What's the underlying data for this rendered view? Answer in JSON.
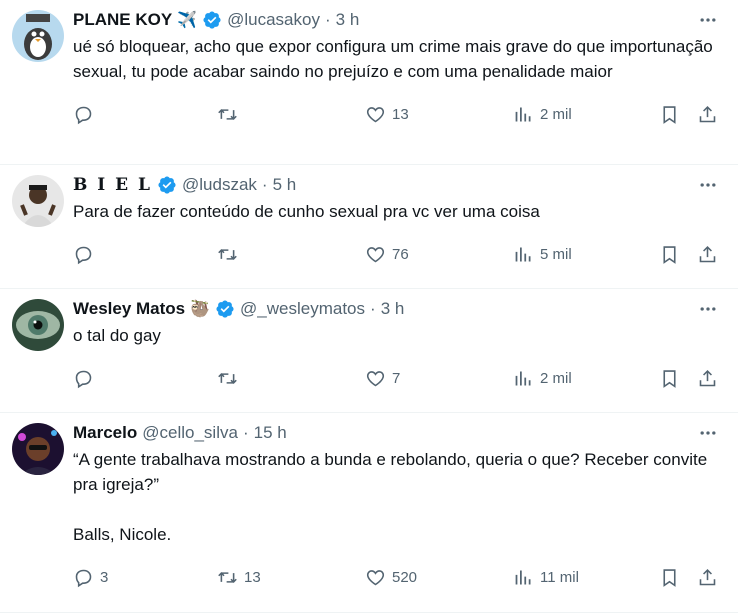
{
  "tweets": [
    {
      "name": "PLANE KOY",
      "emoji": "✈️",
      "handle": "@lucasakoy",
      "dot": "·",
      "time": "3 h",
      "text": "ué só bloquear, acho que expor configura um crime mais grave do que importunação sexual, tu pode acabar saindo no prejuízo e com uma penalidade maior",
      "replies": "",
      "retweets": "",
      "likes": "13",
      "views": "2 mil",
      "avatar_colors": [
        "#b7d9ee",
        "#3b3b3b"
      ]
    },
    {
      "name": "B I E L",
      "emoji": "",
      "handle": "@ludszak",
      "dot": "·",
      "time": "5 h",
      "text": "Para de fazer conteúdo de cunho sexual pra vc ver uma coisa",
      "replies": "",
      "retweets": "",
      "likes": "76",
      "views": "5 mil",
      "avatar_colors": [
        "#e7e7e7",
        "#4a3526"
      ]
    },
    {
      "name": "Wesley Matos",
      "emoji": "🦥",
      "handle": "@_wesleymatos",
      "dot": "·",
      "time": "3 h",
      "text": "o tal do gay",
      "replies": "",
      "retweets": "",
      "likes": "7",
      "views": "2 mil",
      "avatar_colors": [
        "#2f4a3a",
        "#9fb7a4"
      ]
    },
    {
      "name": "Marcelo",
      "emoji": "",
      "handle": "@cello_silva",
      "dot": "·",
      "time": "15 h",
      "text": "“A gente trabalhava mostrando a bunda e rebolando, queria o que? Receber convite pra igreja?”\n\nBalls, Nicole.",
      "replies": "3",
      "retweets": "13",
      "likes": "520",
      "views": "11 mil",
      "avatar_colors": [
        "#1c1030",
        "#6b3f2a"
      ]
    }
  ],
  "colors": {
    "verified": "#1d9bf0",
    "secondary_text": "#536471",
    "border": "#eff3f4"
  },
  "icons": [
    "reply-icon",
    "retweet-icon",
    "like-icon",
    "views-icon",
    "bookmark-icon",
    "share-icon",
    "more-icon",
    "verified-icon"
  ]
}
